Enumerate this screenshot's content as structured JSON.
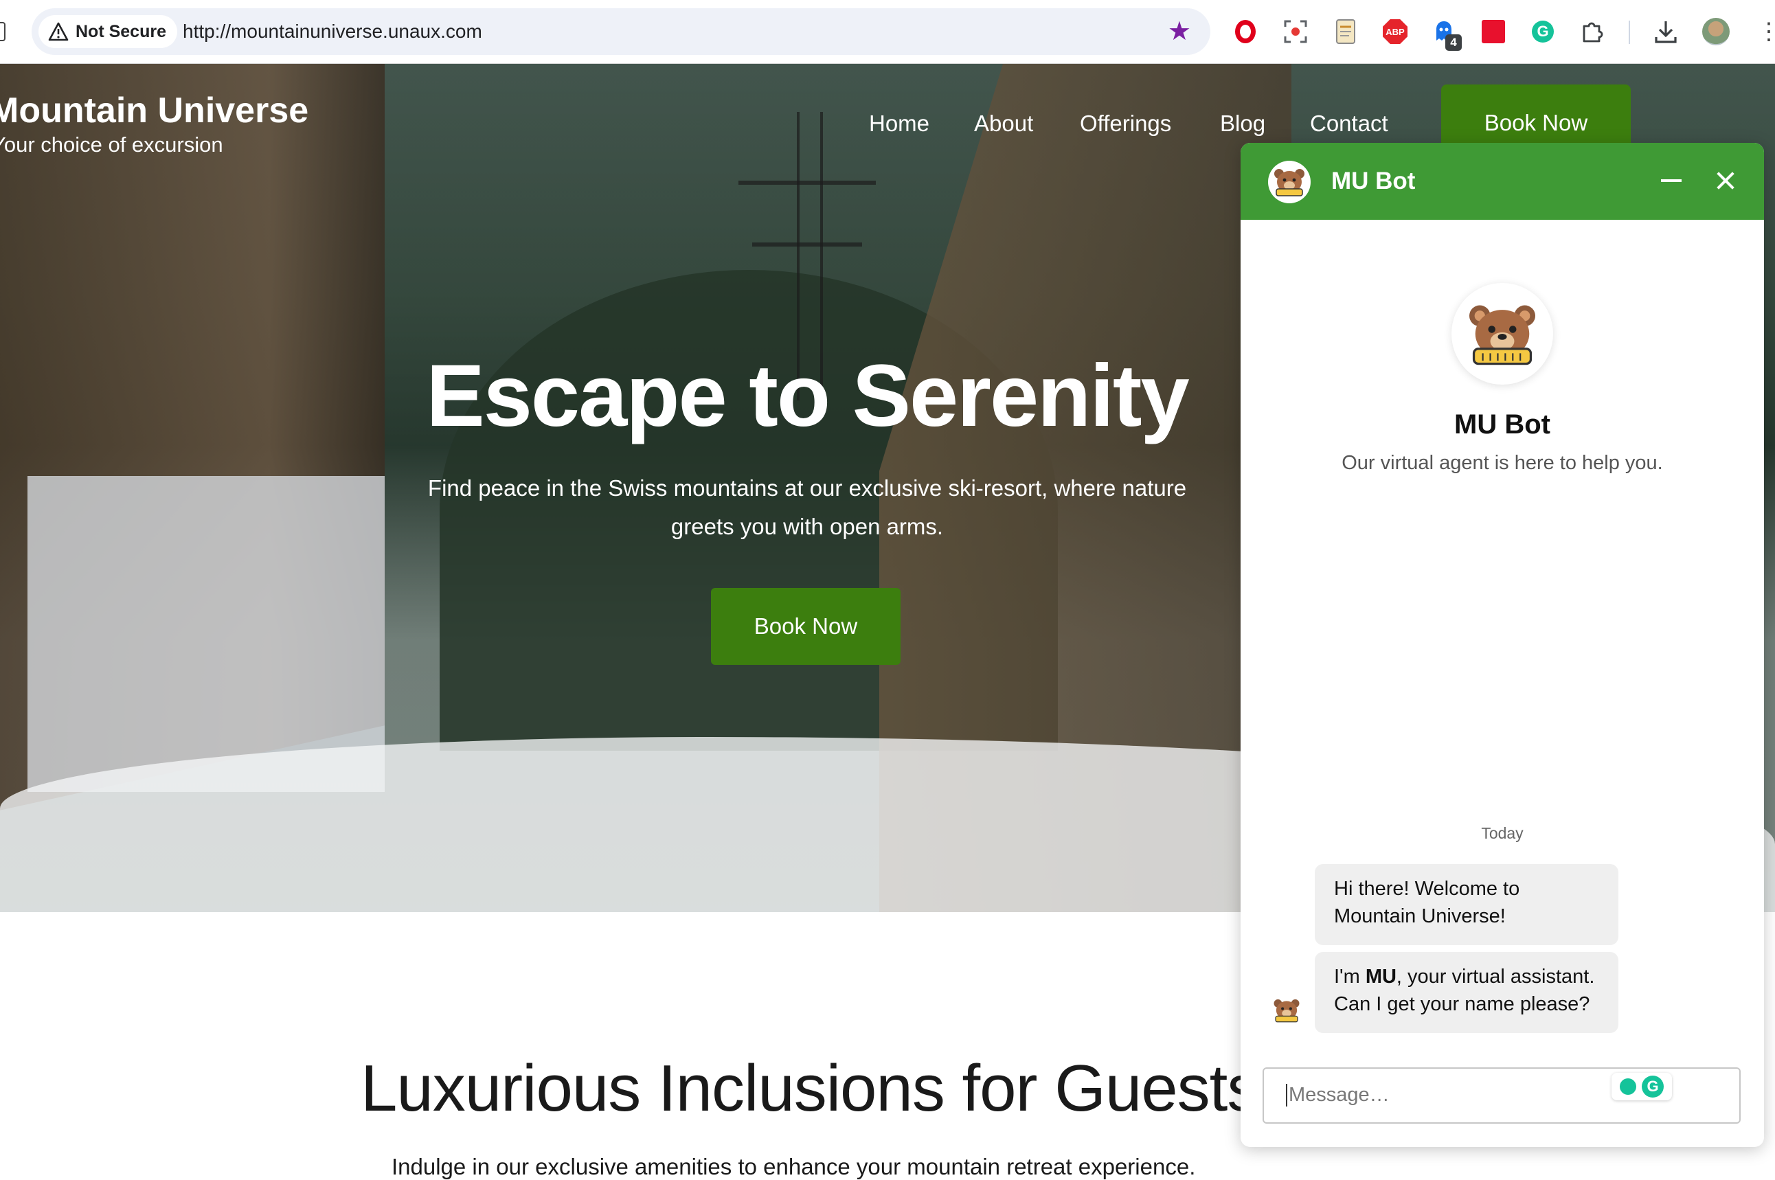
{
  "browser": {
    "security_label": "Not Secure",
    "url": "http://mountainuniverse.unaux.com",
    "extensions": [
      "opera-icon",
      "screen-capture-icon",
      "notes-icon",
      "adblock-plus-icon",
      "ghostery-icon",
      "mendeley-icon",
      "grammarly-icon",
      "extensions-puzzle-icon"
    ],
    "ghostery_badge": "4",
    "abp_label": "ABP",
    "grammarly_glyph": "G"
  },
  "site": {
    "title": "Mountain Universe",
    "tagline": "Your choice of excursion",
    "nav": {
      "home": "Home",
      "about": "About",
      "offerings": "Offerings",
      "blog": "Blog",
      "contact": "Contact",
      "book_now": "Book Now"
    }
  },
  "hero": {
    "heading": "Escape to Serenity",
    "subtitle": "Find peace in the Swiss mountains at our exclusive ski-resort, where nature greets you with open arms.",
    "cta": "Book Now"
  },
  "section": {
    "heading": "Luxurious Inclusions for Guests",
    "subtitle": "Indulge in our exclusive amenities to enhance your mountain retreat experience."
  },
  "chat": {
    "header_title": "MU Bot",
    "bot_name": "MU Bot",
    "bot_description": "Our virtual agent is here to help you.",
    "day_label": "Today",
    "messages": {
      "m1": "Hi there! Welcome to Mountain Universe!",
      "m2_prefix": "I'm ",
      "m2_bold": "MU",
      "m2_suffix": ", your virtual assistant. Can I get your name please?"
    },
    "input_placeholder": "Message…",
    "accent_color": "#3f9a35"
  },
  "colors": {
    "cta_green": "#3c7e0e",
    "bookmark_star": "#7b1fa2"
  }
}
